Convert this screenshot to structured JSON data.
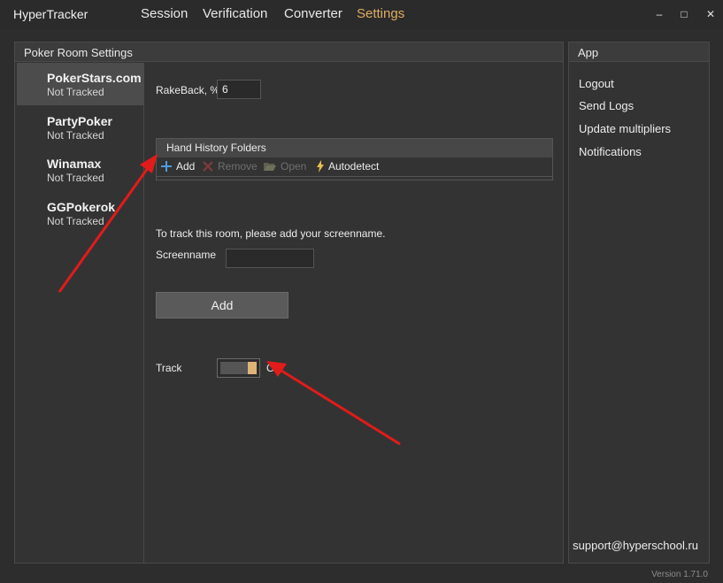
{
  "app": {
    "title": "HyperTracker",
    "version": "Version 1.71.0"
  },
  "nav": {
    "tabs": [
      "Session",
      "Verification",
      "Converter",
      "Settings"
    ],
    "active": "Settings"
  },
  "window_controls": {
    "minimize": "–",
    "maximize": "□",
    "close": "✕"
  },
  "poker_room_settings": {
    "title": "Poker Room Settings",
    "rooms": [
      {
        "name": "PokerStars.com",
        "status": "Not Tracked",
        "selected": true
      },
      {
        "name": "PartyPoker",
        "status": "Not Tracked"
      },
      {
        "name": "Winamax",
        "status": "Not Tracked"
      },
      {
        "name": "GGPokerok",
        "status": "Not Tracked"
      }
    ],
    "rakeback_label": "RakeBack, %",
    "rakeback_value": "6",
    "hand_history": {
      "title": "Hand History Folders",
      "toolbar": {
        "add": "Add",
        "remove": "Remove",
        "open": "Open",
        "autodetect": "Autodetect"
      }
    },
    "track_prompt": "To track this room, please add your screenname.",
    "screenname_label": "Screenname",
    "screenname_value": "",
    "add_button": "Add",
    "track_label": "Track",
    "track_state": "ON",
    "track_on": true
  },
  "app_panel": {
    "title": "App",
    "links": [
      "Logout",
      "Send Logs",
      "Update multipliers",
      "Notifications"
    ],
    "support_email": "support@hyperschool.ru"
  },
  "colors": {
    "accent": "#e0ad62",
    "toggle_knob": "#dfb375",
    "arrow": "#e21b1b"
  }
}
